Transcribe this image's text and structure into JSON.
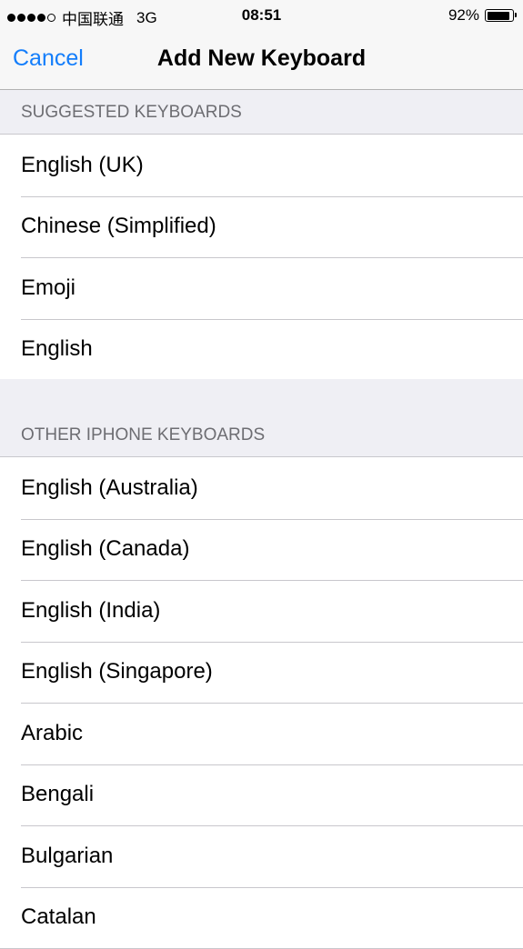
{
  "status_bar": {
    "signal_bars_filled": 4,
    "signal_bars_total": 5,
    "carrier": "中国联通",
    "network": "3G",
    "time": "08:51",
    "battery_percent_label": "92%",
    "battery_level": 0.92
  },
  "nav": {
    "cancel_label": "Cancel",
    "title": "Add New Keyboard",
    "accent_color": "#147efb"
  },
  "sections": {
    "suggested": {
      "header": "SUGGESTED KEYBOARDS",
      "items": [
        "English (UK)",
        "Chinese (Simplified)",
        "Emoji",
        "English"
      ]
    },
    "other": {
      "header": "OTHER IPHONE KEYBOARDS",
      "items": [
        "English (Australia)",
        "English (Canada)",
        "English (India)",
        "English (Singapore)",
        "Arabic",
        "Bengali",
        "Bulgarian",
        "Catalan"
      ]
    }
  }
}
